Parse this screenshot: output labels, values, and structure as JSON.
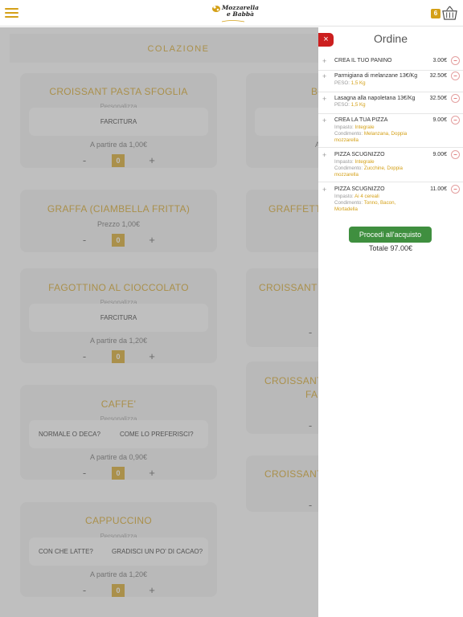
{
  "header": {
    "logo_line1": "Mozzarella",
    "logo_line2": "e Babbà",
    "cart_count": "6"
  },
  "section": {
    "title": "COLAZIONE"
  },
  "cards_left": [
    {
      "title": "CROISSANT PASTA SFOGLIA",
      "sub": "Personalizza",
      "options": [
        "FARCITURA"
      ],
      "price": "A partire da 1,00€",
      "qty": "0"
    },
    {
      "title": "GRAFFA (CIAMBELLA FRITTA)",
      "price": "Prezzo 1,00€",
      "qty": "0"
    },
    {
      "title": "FAGOTTINO AL CIOCCOLATO",
      "sub": "Personalizza",
      "options": [
        "FARCITURA"
      ],
      "price": "A partire da 1,20€",
      "qty": "0"
    },
    {
      "title": "CAFFE'",
      "sub": "Personalizza",
      "options": [
        "NORMALE O DECA?",
        "COME LO PREFERISCI?"
      ],
      "price": "A partire da 0,90€",
      "qty": "0"
    },
    {
      "title": "CAPPUCCINO",
      "sub": "Personalizza",
      "options": [
        "CON CHE LATTE?",
        "GRADISCI UN PO' DI CACAO?"
      ],
      "price": "A partire da 1,20€",
      "qty": "0"
    }
  ],
  "cards_right": [
    {
      "title": "BO"
    },
    {
      "title": "GRAFFETTA"
    },
    {
      "title": "CROISSANT PA"
    },
    {
      "title": "CROISSANT I",
      "title2": "FA"
    },
    {
      "title": "CROISSANT"
    }
  ],
  "qty_controls": {
    "minus": "-",
    "plus": "+"
  },
  "order_panel": {
    "close": "×",
    "title": "Ordine",
    "items": [
      {
        "name": "CREA IL TUO PANINO",
        "price": "3.00€"
      },
      {
        "name": "Parmigiana di melanzane 13€/Kg",
        "price": "32.50€",
        "details": [
          {
            "label": "PESO:",
            "value": "1,5 Kg"
          }
        ]
      },
      {
        "name": "Lasagna alla napoletana 13€/Kg",
        "price": "32.50€",
        "details": [
          {
            "label": "PESO:",
            "value": "1,5 Kg"
          }
        ]
      },
      {
        "name": "CREA LA TUA PIZZA",
        "price": "9.00€",
        "details": [
          {
            "label": "Impasto:",
            "value": "Integrale"
          },
          {
            "label": "Condimento:",
            "value": "Melanzana, Doppia"
          },
          {
            "label": "",
            "value": "mozzarella"
          }
        ]
      },
      {
        "name": "PIZZA SCUGNIZZO",
        "price": "9.00€",
        "details": [
          {
            "label": "Impasto:",
            "value": "Integrale"
          },
          {
            "label": "Condimento:",
            "value": "Zucchine, Doppia"
          },
          {
            "label": "",
            "value": "mozzarella"
          }
        ]
      },
      {
        "name": "PIZZA SCUGNIZZO",
        "price": "11.00€",
        "details": [
          {
            "label": "Impasto:",
            "value": "Ai 4 cereali"
          },
          {
            "label": "Condimento:",
            "value": "Tonno, Bacon,"
          },
          {
            "label": "",
            "value": "Mortadella"
          }
        ]
      }
    ],
    "item_plus": "+",
    "item_minus": "−",
    "checkout_label": "Procedi all'acquisto",
    "total": "Totale 97.00€"
  }
}
